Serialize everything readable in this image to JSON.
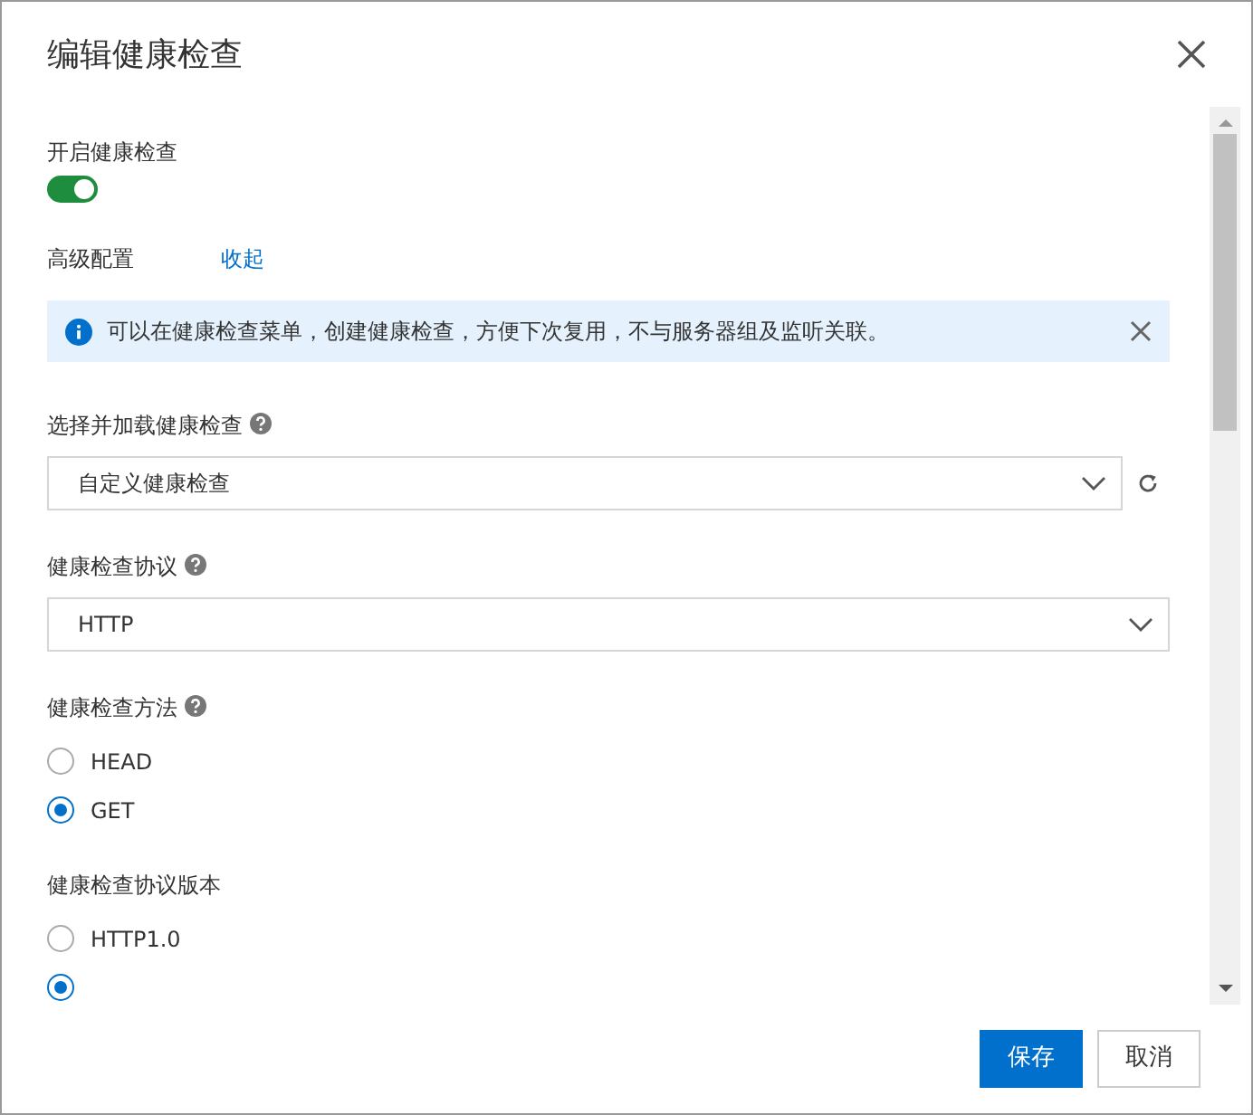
{
  "dialog": {
    "title": "编辑健康检查"
  },
  "health_check": {
    "label": "开启健康检查",
    "on": true
  },
  "advanced": {
    "label": "高级配置",
    "link": "收起"
  },
  "alert": {
    "text": "可以在健康检查菜单，创建健康检查，方便下次复用，不与服务器组及监听关联。"
  },
  "template_select": {
    "label": "选择并加载健康检查",
    "value": "自定义健康检查"
  },
  "protocol_select": {
    "label": "健康检查协议",
    "value": "HTTP"
  },
  "method": {
    "label": "健康检查方法",
    "options": [
      {
        "label": "HEAD",
        "selected": false
      },
      {
        "label": "GET",
        "selected": true
      }
    ]
  },
  "version": {
    "label": "健康检查协议版本",
    "options": [
      {
        "label": "HTTP1.0",
        "selected": false
      },
      {
        "selected": true
      }
    ]
  },
  "buttons": [
    {
      "label": "保存",
      "kind": "primary"
    },
    {
      "label": "取消",
      "kind": "secondary"
    }
  ]
}
